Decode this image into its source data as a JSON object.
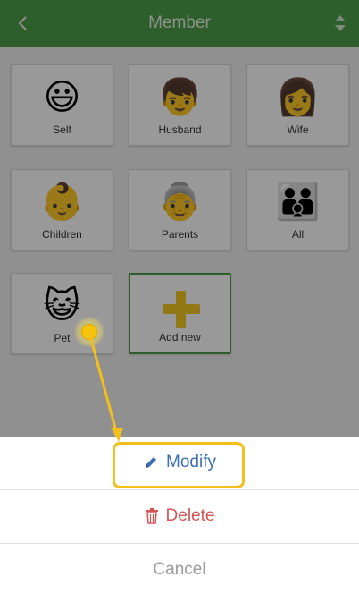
{
  "header": {
    "title": "Member",
    "back_icon": "chevron-left-icon",
    "sort_icon": "sort-icon"
  },
  "members": [
    {
      "label": "Self",
      "emoji": "😃",
      "icon": "smiley-face-icon"
    },
    {
      "label": "Husband",
      "emoji": "👦",
      "icon": "boy-icon"
    },
    {
      "label": "Wife",
      "emoji": "👩",
      "icon": "woman-icon"
    },
    {
      "label": "Children",
      "emoji": "👶",
      "icon": "baby-icon"
    },
    {
      "label": "Parents",
      "emoji": "👵",
      "icon": "grandma-icon"
    },
    {
      "label": "All",
      "emoji": "👪",
      "icon": "family-icon"
    },
    {
      "label": "Pet",
      "emoji": "😺",
      "icon": "cat-face-icon"
    }
  ],
  "add_new": {
    "label": "Add new",
    "icon": "plus-icon"
  },
  "sheet": {
    "modify": "Modify",
    "delete": "Delete",
    "cancel": "Cancel"
  },
  "colors": {
    "header": "#4f9d4c",
    "modify": "#3a6fb0",
    "delete": "#d45454",
    "cancel": "#9a9a9a",
    "highlight": "#f2bf1d"
  }
}
